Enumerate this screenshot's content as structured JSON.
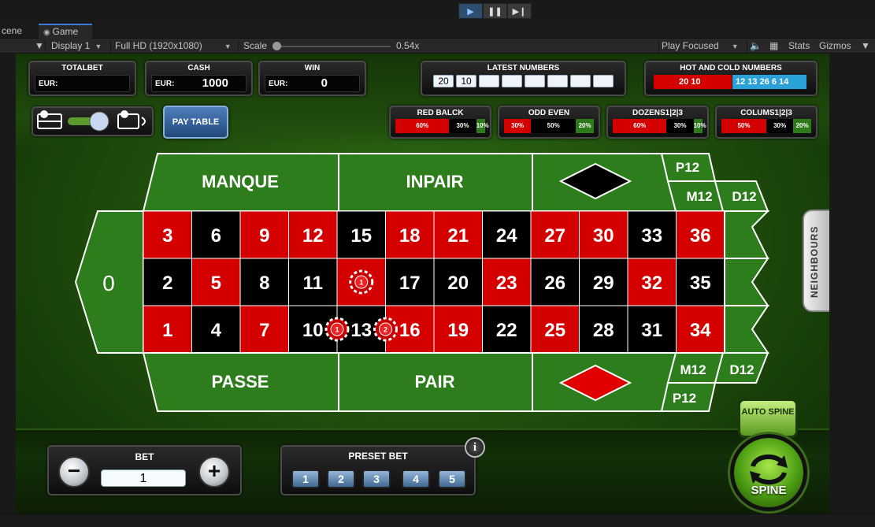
{
  "editor": {
    "tabs": [
      "cene",
      "Game"
    ],
    "toolbar": {
      "display": "Display 1",
      "resolution": "Full HD (1920x1080)",
      "scale_label": "Scale",
      "scale_value": "0.54x",
      "play_focused": "Play Focused",
      "stats": "Stats",
      "gizmos": "Gizmos"
    }
  },
  "game": {
    "totalbet": {
      "title": "TOTALBET",
      "currency": "EUR:",
      "value": ""
    },
    "cash": {
      "title": "CASH",
      "currency": "EUR:",
      "value": "1000"
    },
    "win": {
      "title": "WIN",
      "currency": "EUR:",
      "value": "0"
    },
    "latest": {
      "title": "LATEST NUMBERS",
      "numbers": [
        "20",
        "10",
        "",
        "",
        "",
        "",
        "",
        ""
      ]
    },
    "hotcold": {
      "title": "HOT AND COLD NUMBERS",
      "hot": "20 10",
      "cold": "12 13 26 6 14"
    },
    "stats": [
      {
        "title": "RED BALCK",
        "segments": [
          {
            "label": "60%",
            "pct": 60,
            "color": "#d40000"
          },
          {
            "label": "30%",
            "pct": 30,
            "color": "#000000"
          },
          {
            "label": "10%",
            "pct": 10,
            "color": "#2d7a1b"
          }
        ]
      },
      {
        "title": "ODD EVEN",
        "segments": [
          {
            "label": "30%",
            "pct": 30,
            "color": "#d40000"
          },
          {
            "label": "50%",
            "pct": 50,
            "color": "#000000"
          },
          {
            "label": "20%",
            "pct": 20,
            "color": "#2d7a1b"
          }
        ]
      },
      {
        "title": "DOZENS1|2|3",
        "segments": [
          {
            "label": "60%",
            "pct": 60,
            "color": "#d40000"
          },
          {
            "label": "30%",
            "pct": 30,
            "color": "#000000"
          },
          {
            "label": "10%",
            "pct": 10,
            "color": "#2d7a1b"
          }
        ]
      },
      {
        "title": "COLUMS1|2|3",
        "segments": [
          {
            "label": "50%",
            "pct": 50,
            "color": "#d40000"
          },
          {
            "label": "30%",
            "pct": 30,
            "color": "#000000"
          },
          {
            "label": "20%",
            "pct": 20,
            "color": "#2d7a1b"
          }
        ]
      }
    ],
    "paytable": "PAY TABLE",
    "neighbours": "NEIGHBOURS",
    "table": {
      "zero": "0",
      "manque": "MANQUE",
      "inpair": "INPAIR",
      "passe": "PASSE",
      "pair": "PAIR",
      "top_labels": {
        "p12": "P12",
        "m12": "M12",
        "d12": "D12"
      },
      "bottom_labels": {
        "m12": "M12",
        "d12": "D12",
        "p12": "P12"
      },
      "red_numbers": [
        1,
        3,
        5,
        7,
        9,
        12,
        14,
        16,
        18,
        19,
        21,
        23,
        25,
        27,
        30,
        32,
        34,
        36
      ],
      "chips": [
        {
          "label": "1",
          "on": "14"
        },
        {
          "label": "1",
          "on": "10-13"
        },
        {
          "label": "2",
          "on": "13-16"
        }
      ]
    },
    "bet": {
      "title": "BET",
      "minus": "−",
      "plus": "+",
      "value": "1"
    },
    "preset": {
      "title": "PRESET BET",
      "buttons": [
        "1",
        "2",
        "3",
        "4",
        "5"
      ],
      "info": "i"
    },
    "autospine": "AUTO SPINE",
    "spine": "SPINE"
  }
}
